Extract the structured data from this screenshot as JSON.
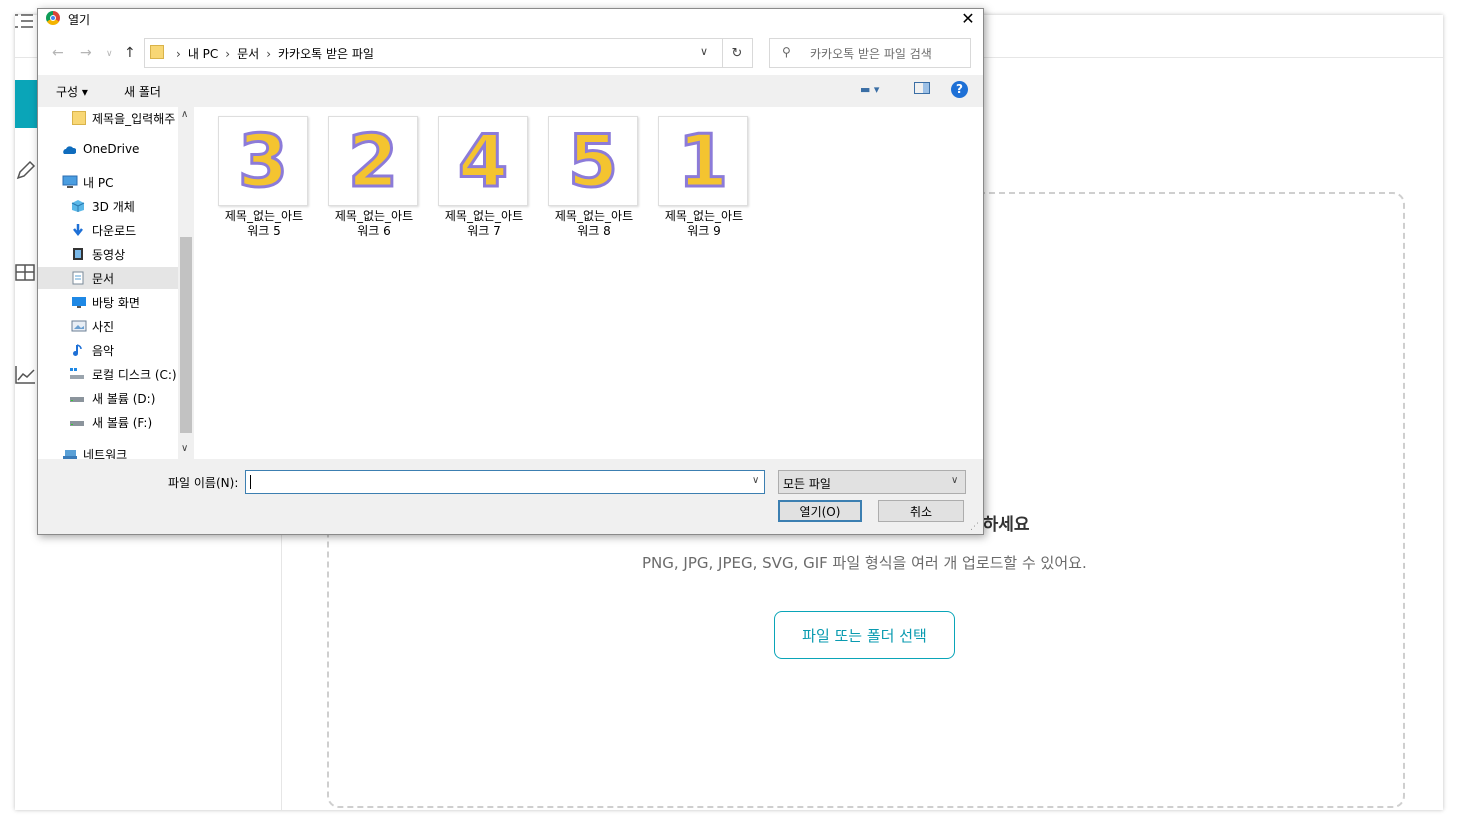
{
  "background_app": {
    "dropzone_title": "드하세요",
    "dropzone_subtitle": "PNG, JPG, JPEG, SVG, GIF 파일 형식을 여러 개 업로드할 수 있어요.",
    "select_button": "파일 또는 폴더 선택",
    "accent_color": "#0aa5b8"
  },
  "dialog": {
    "title": "열기",
    "close_glyph": "✕",
    "breadcrumb": [
      "내 PC",
      "문서",
      "카카오톡 받은 파일"
    ],
    "search_placeholder": "카카오톡 받은 파일 검색",
    "toolbar": {
      "organize": "구성 ▾",
      "new_folder": "새 폴더",
      "help": "?"
    },
    "nav_items": [
      {
        "label": "제목을_입력해주",
        "icon": "folder-icon"
      },
      {
        "label": "OneDrive",
        "icon": "cloud-icon"
      },
      {
        "label": "내 PC",
        "icon": "pc-icon"
      },
      {
        "label": "3D 개체",
        "icon": "cube-icon"
      },
      {
        "label": "다운로드",
        "icon": "download-icon"
      },
      {
        "label": "동영상",
        "icon": "video-icon"
      },
      {
        "label": "문서",
        "icon": "document-icon"
      },
      {
        "label": "바탕 화면",
        "icon": "desktop-icon"
      },
      {
        "label": "사진",
        "icon": "picture-icon"
      },
      {
        "label": "음악",
        "icon": "music-icon"
      },
      {
        "label": "로컬 디스크 (C:)",
        "icon": "drive-icon"
      },
      {
        "label": "새 볼륨 (D:)",
        "icon": "drive-icon"
      },
      {
        "label": "새 볼륨 (F:)",
        "icon": "drive-icon"
      },
      {
        "label": "네트워크",
        "icon": "network-icon"
      }
    ],
    "files": [
      {
        "digit": "3",
        "name_line1": "제목_없는_아트",
        "name_line2": "워크 5"
      },
      {
        "digit": "2",
        "name_line1": "제목_없는_아트",
        "name_line2": "워크 6"
      },
      {
        "digit": "4",
        "name_line1": "제목_없는_아트",
        "name_line2": "워크 7"
      },
      {
        "digit": "5",
        "name_line1": "제목_없는_아트",
        "name_line2": "워크 8"
      },
      {
        "digit": "1",
        "name_line1": "제목_없는_아트",
        "name_line2": "워크 9"
      }
    ],
    "filename_label": "파일 이름(N):",
    "filename_value": "",
    "file_type": "모든 파일",
    "open_button": "열기(O)",
    "cancel_button": "취소"
  }
}
